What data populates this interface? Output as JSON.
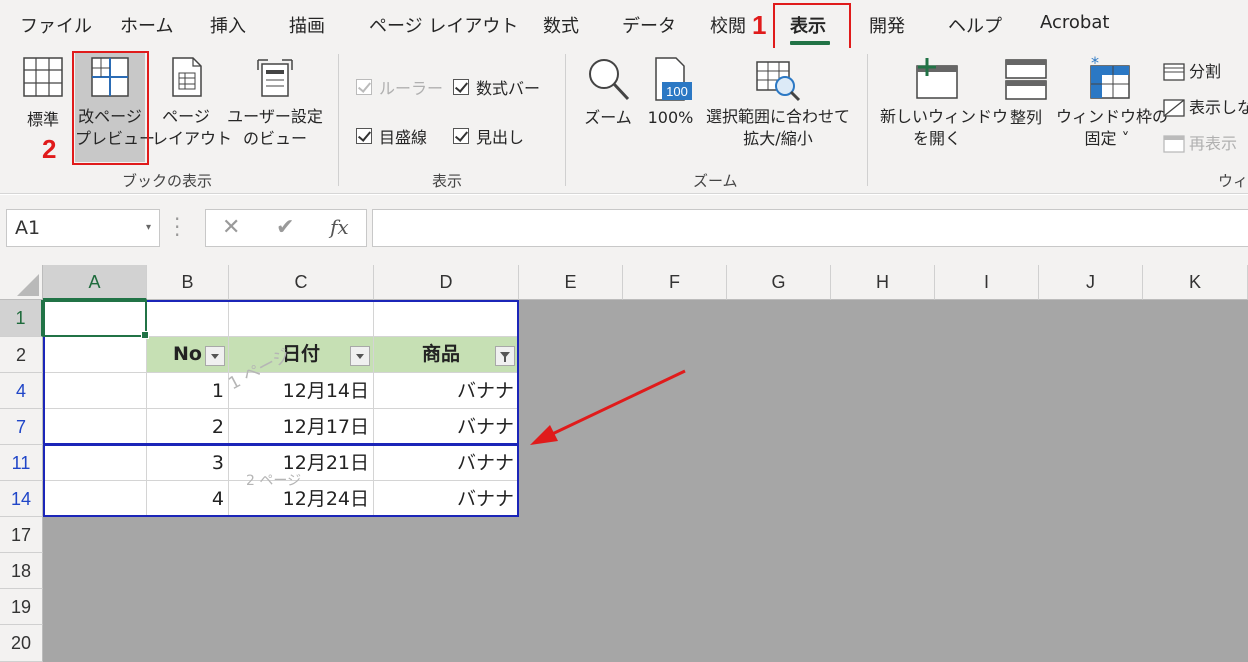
{
  "tabs": [
    {
      "label": "ファイル",
      "active": false
    },
    {
      "label": "ホーム",
      "active": false
    },
    {
      "label": "挿入",
      "active": false
    },
    {
      "label": "描画",
      "active": false
    },
    {
      "label": "ページ レイアウト",
      "active": false
    },
    {
      "label": "数式",
      "active": false
    },
    {
      "label": "データ",
      "active": false
    },
    {
      "label": "校閲",
      "active": false
    },
    {
      "label": "表示",
      "active": true
    },
    {
      "label": "開発",
      "active": false
    },
    {
      "label": "ヘルプ",
      "active": false
    },
    {
      "label": "Acrobat",
      "active": false
    }
  ],
  "annotations": {
    "step1": "1",
    "step2": "2",
    "highlight_color": "#e01b1b"
  },
  "ribbon": {
    "workbook_views": {
      "group_label": "ブックの表示",
      "normal": "標準",
      "page_break_preview": [
        "改ページ",
        "プレビュー"
      ],
      "page_layout": [
        "ページ",
        "レイアウト"
      ],
      "custom_views": [
        "ユーザー設定",
        "のビュー"
      ]
    },
    "show": {
      "group_label": "表示",
      "ruler": "ルーラー",
      "formula_bar": "数式バー",
      "gridlines": "目盛線",
      "headings": "見出し"
    },
    "zoom": {
      "group_label": "ズーム",
      "zoom": "ズーム",
      "zoom_100": "100%",
      "zoom_100_icon_text": "100",
      "zoom_to_selection": [
        "選択範囲に合わせて",
        "拡大/縮小"
      ]
    },
    "window": {
      "group_label": "ウィン",
      "new_window": [
        "新しいウィンドウ",
        "を開く"
      ],
      "arrange_all": "整列",
      "freeze_panes": [
        "ウィンドウ枠の",
        "固定 ˅"
      ],
      "split": "分割",
      "hide": "表示しな",
      "unhide": "再表示"
    }
  },
  "formula_bar": {
    "name_box": "A1",
    "cancel": "✕",
    "enter": "✔",
    "fx": "fx",
    "formula": ""
  },
  "sheet": {
    "columns": [
      "A",
      "B",
      "C",
      "D",
      "E",
      "F",
      "G",
      "H",
      "I",
      "J",
      "K"
    ],
    "rows": [
      "1",
      "2",
      "4",
      "7",
      "11",
      "14",
      "17",
      "18",
      "19",
      "20"
    ],
    "header": {
      "no": "No",
      "date": "日付",
      "product": "商品"
    },
    "data": [
      {
        "no": "1",
        "date": "12月14日",
        "product": "バナナ"
      },
      {
        "no": "2",
        "date": "12月17日",
        "product": "バナナ"
      },
      {
        "no": "3",
        "date": "12月21日",
        "product": "バナナ"
      },
      {
        "no": "4",
        "date": "12月24日",
        "product": "バナナ"
      }
    ],
    "page1_watermark": "1 ページ",
    "page2_watermark": "2 ページ"
  }
}
